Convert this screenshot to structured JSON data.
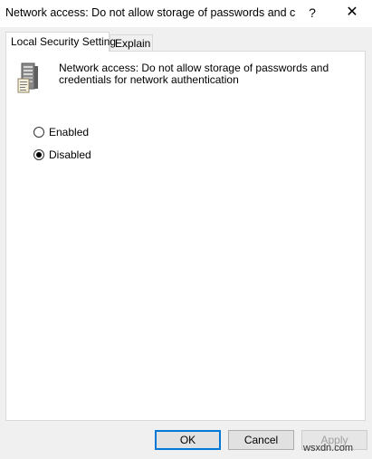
{
  "window": {
    "title": "Network access: Do not allow storage of passwords and cr...",
    "help_glyph": "?",
    "close_glyph": "✕"
  },
  "tabs": [
    {
      "label": "Local Security Setting",
      "active": true
    },
    {
      "label": "Explain",
      "active": false
    }
  ],
  "policy": {
    "icon": "server-policy-icon",
    "description": "Network access: Do not allow storage of passwords and credentials for network authentication"
  },
  "options": [
    {
      "label": "Enabled",
      "selected": false
    },
    {
      "label": "Disabled",
      "selected": true
    }
  ],
  "buttons": {
    "ok": "OK",
    "cancel": "Cancel",
    "apply": "Apply"
  },
  "watermark": "wsxdn.com",
  "colors": {
    "focus_border": "#0078d7",
    "disabled_text": "#a0a0a0"
  }
}
